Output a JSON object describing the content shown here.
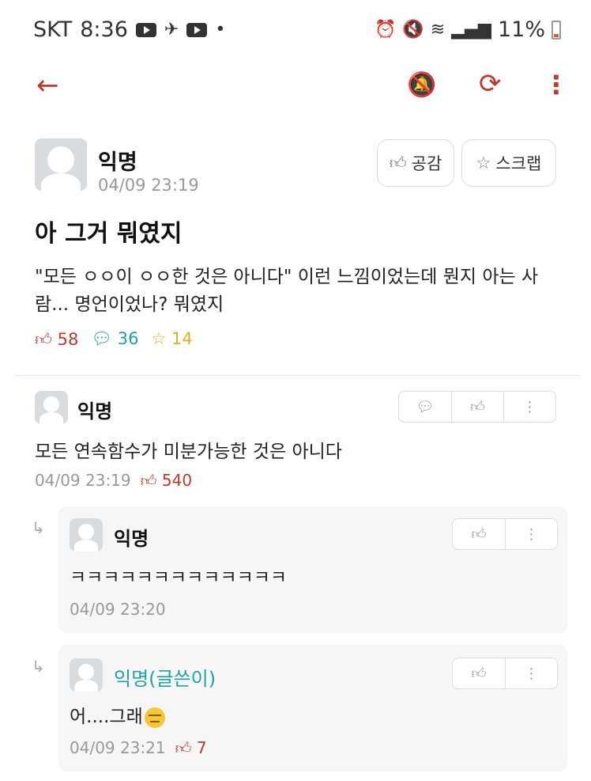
{
  "status_bar": {
    "carrier": "SKT",
    "time": "8:36",
    "battery": "11%"
  },
  "post": {
    "author": "익명",
    "timestamp": "04/09 23:19",
    "like_button": "공감",
    "scrap_button": "스크랩",
    "title": "아 그거 뭐였지",
    "body": "\"모든 ㅇㅇ이 ㅇㅇ한 것은 아니다\" 이런 느낌이었는데 뭔지 아는 사람... 명언이었나? 뭐였지",
    "stats": {
      "likes": "58",
      "comments": "36",
      "scraps": "14"
    }
  },
  "comments": [
    {
      "author": "익명",
      "text": "모든 연속함수가 미분가능한 것은 아니다",
      "timestamp": "04/09 23:19",
      "likes": "540"
    }
  ],
  "replies": [
    {
      "author": "익명",
      "text": "ㅋㅋㅋㅋㅋㅋㅋㅋㅋㅋㅋㅋㅋ",
      "timestamp": "04/09 23:20",
      "likes": ""
    },
    {
      "author": "익명(글쓴이)",
      "text": "어....그래",
      "timestamp": "04/09 23:21",
      "likes": "7"
    }
  ],
  "colors": {
    "accent": "#c0392b",
    "writer": "#1fa3a3",
    "scrap": "#e0b020"
  }
}
